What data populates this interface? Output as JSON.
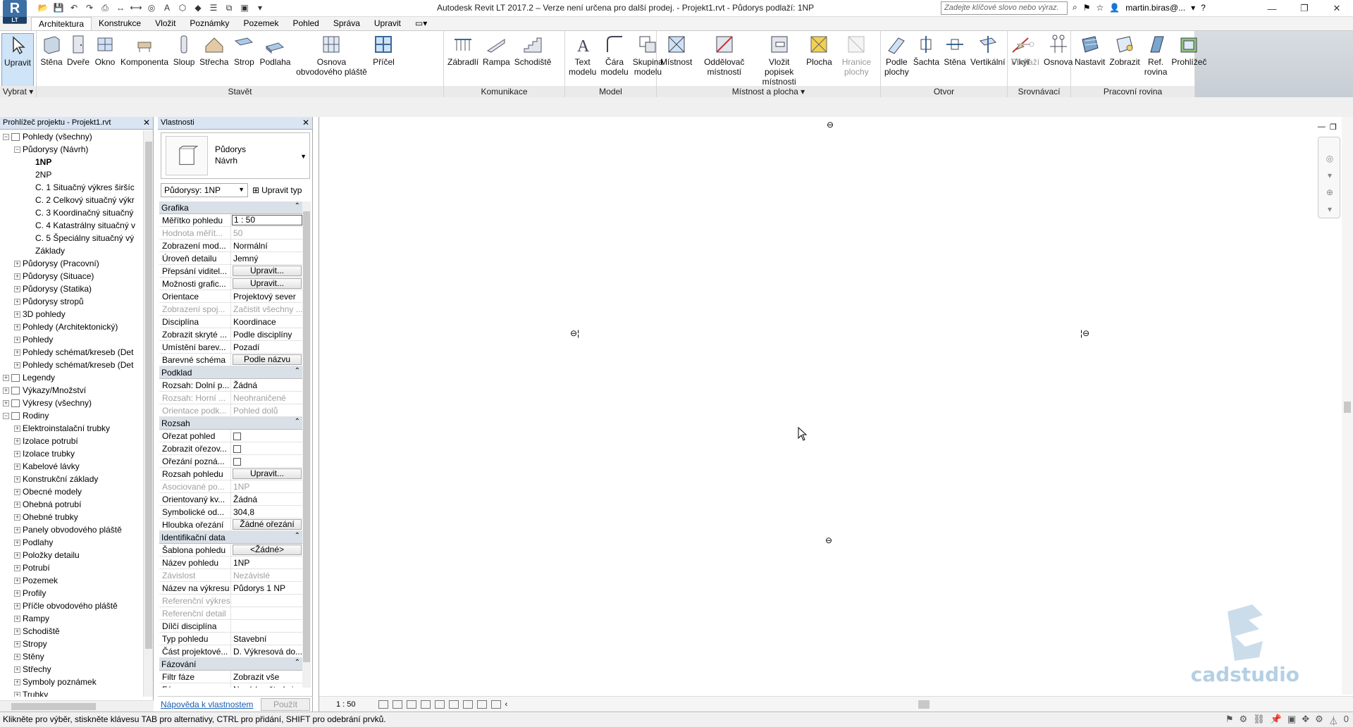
{
  "app": {
    "logo": "R",
    "logo_sub": "LT",
    "title": "Autodesk Revit LT 2017.2 – Verze není určena pro další prodej. -    Projekt1.rvt - Půdorys podlaží: 1NP",
    "search_placeholder": "Zadejte klíčové slovo nebo výraz.",
    "user": "martin.biras@...",
    "help": "?"
  },
  "tabs": [
    "Architektura",
    "Konstrukce",
    "Vložit",
    "Poznámky",
    "Pozemek",
    "Pohled",
    "Správa",
    "Upravit"
  ],
  "ribbon": {
    "panels": [
      {
        "title": "Vybrat ▾",
        "buttons": [
          "Upravit"
        ]
      },
      {
        "title": "Stavět",
        "buttons": [
          "Stěna",
          "Dveře",
          "Okno",
          "Komponenta",
          "Sloup",
          "Střecha",
          "Strop",
          "Podlaha",
          "Osnova obvodového pláště",
          "Příčel"
        ]
      },
      {
        "title": "Komunikace",
        "buttons": [
          "Zábradlí",
          "Rampa",
          "Schodiště"
        ]
      },
      {
        "title": "Model",
        "buttons": [
          "Text modelu",
          "Čára modelu",
          "Skupina modelu"
        ]
      },
      {
        "title": "Místnost a plocha ▾",
        "buttons": [
          "Místnost",
          "Oddělovač místností",
          "Vložit popisek místnosti",
          "Plocha",
          "Hranice plochy"
        ]
      },
      {
        "title": "Otvor",
        "buttons": [
          "Podle plochy",
          "Šachta",
          "Stěna",
          "Vertikální",
          "Vikýř"
        ]
      },
      {
        "title": "Srovnávací rovina",
        "buttons": [
          "Podlaží",
          "Osnova"
        ]
      },
      {
        "title": "Pracovní rovina",
        "buttons": [
          "Nastavit",
          "Zobrazit",
          "Ref. rovina",
          "Prohlížeč"
        ]
      }
    ]
  },
  "browser": {
    "title": "Prohlížeč projektu - Projekt1.rvt",
    "items": [
      {
        "label": "Pohledy (všechny)",
        "level": 0,
        "tog": "−",
        "icon": true
      },
      {
        "label": "Půdorysy (Návrh)",
        "level": 1,
        "tog": "−"
      },
      {
        "label": "1NP",
        "level": 2,
        "bold": true
      },
      {
        "label": "2NP",
        "level": 2
      },
      {
        "label": "C. 1 Situačný výkres širšíc",
        "level": 2
      },
      {
        "label": "C. 2 Celkový situačný výkr",
        "level": 2
      },
      {
        "label": "C. 3 Koordinačný situačný",
        "level": 2
      },
      {
        "label": "C. 4 Katastrálny situačný v",
        "level": 2
      },
      {
        "label": "C. 5 Špeciálny situačný vý",
        "level": 2
      },
      {
        "label": "Základy",
        "level": 2
      },
      {
        "label": "Půdorysy (Pracovní)",
        "level": 1,
        "tog": "+"
      },
      {
        "label": "Půdorysy (Situace)",
        "level": 1,
        "tog": "+"
      },
      {
        "label": "Půdorysy (Statika)",
        "level": 1,
        "tog": "+"
      },
      {
        "label": "Půdorysy stropů",
        "level": 1,
        "tog": "+"
      },
      {
        "label": "3D pohledy",
        "level": 1,
        "tog": "+"
      },
      {
        "label": "Pohledy (Architektonický)",
        "level": 1,
        "tog": "+"
      },
      {
        "label": "Pohledy",
        "level": 1,
        "tog": "+"
      },
      {
        "label": "Pohledy schémat/kreseb (Det",
        "level": 1,
        "tog": "+"
      },
      {
        "label": "Pohledy schémat/kreseb (Det",
        "level": 1,
        "tog": "+"
      },
      {
        "label": "Legendy",
        "level": 0,
        "tog": "+",
        "icon": true
      },
      {
        "label": "Výkazy/Množství",
        "level": 0,
        "tog": "+",
        "icon": true
      },
      {
        "label": "Výkresy (všechny)",
        "level": 0,
        "tog": "+",
        "icon": true
      },
      {
        "label": "Rodiny",
        "level": 0,
        "tog": "−",
        "icon": true
      },
      {
        "label": "Elektroinstalační trubky",
        "level": 1,
        "tog": "+"
      },
      {
        "label": "Izolace potrubí",
        "level": 1,
        "tog": "+"
      },
      {
        "label": "Izolace trubky",
        "level": 1,
        "tog": "+"
      },
      {
        "label": "Kabelové lávky",
        "level": 1,
        "tog": "+"
      },
      {
        "label": "Konstrukční základy",
        "level": 1,
        "tog": "+"
      },
      {
        "label": "Obecné modely",
        "level": 1,
        "tog": "+"
      },
      {
        "label": "Ohebná potrubí",
        "level": 1,
        "tog": "+"
      },
      {
        "label": "Ohebné trubky",
        "level": 1,
        "tog": "+"
      },
      {
        "label": "Panely obvodového pláště",
        "level": 1,
        "tog": "+"
      },
      {
        "label": "Podlahy",
        "level": 1,
        "tog": "+"
      },
      {
        "label": "Položky detailu",
        "level": 1,
        "tog": "+"
      },
      {
        "label": "Potrubí",
        "level": 1,
        "tog": "+"
      },
      {
        "label": "Pozemek",
        "level": 1,
        "tog": "+"
      },
      {
        "label": "Profily",
        "level": 1,
        "tog": "+"
      },
      {
        "label": "Příčle obvodového pláště",
        "level": 1,
        "tog": "+"
      },
      {
        "label": "Rampy",
        "level": 1,
        "tog": "+"
      },
      {
        "label": "Schodiště",
        "level": 1,
        "tog": "+"
      },
      {
        "label": "Stropy",
        "level": 1,
        "tog": "+"
      },
      {
        "label": "Stěny",
        "level": 1,
        "tog": "+"
      },
      {
        "label": "Střechy",
        "level": 1,
        "tog": "+"
      },
      {
        "label": "Symboly poznámek",
        "level": 1,
        "tog": "+"
      },
      {
        "label": "Trubky",
        "level": 1,
        "tog": "+"
      }
    ]
  },
  "properties": {
    "title": "Vlastnosti",
    "type_line1": "Půdorys",
    "type_line2": "Návrh",
    "instance": "Půdorysy: 1NP",
    "edit_type": "Upravit typ",
    "help": "Nápověda k vlastnostem",
    "apply": "Použít",
    "groups": [
      {
        "name": "Grafika",
        "rows": [
          {
            "k": "Měřítko pohledu",
            "v": "1 : 50",
            "kind": "input"
          },
          {
            "k": "Hodnota měřít...",
            "v": "50",
            "dis": true
          },
          {
            "k": "Zobrazení mod...",
            "v": "Normální"
          },
          {
            "k": "Úroveň detailu",
            "v": "Jemný"
          },
          {
            "k": "Přepsání viditel...",
            "v": "Upravit...",
            "kind": "btn"
          },
          {
            "k": "Možnosti grafic...",
            "v": "Upravit...",
            "kind": "btn"
          },
          {
            "k": "Orientace",
            "v": "Projektový sever"
          },
          {
            "k": "Zobrazení spoj...",
            "v": "Začistit všechny ...",
            "dis": true
          },
          {
            "k": "Disciplína",
            "v": "Koordinace"
          },
          {
            "k": "Zobrazit skryté ...",
            "v": "Podle disciplíny"
          },
          {
            "k": "Umístění barev...",
            "v": "Pozadí"
          },
          {
            "k": "Barevné schéma",
            "v": "Podle názvu",
            "kind": "btn"
          }
        ]
      },
      {
        "name": "Podklad",
        "rows": [
          {
            "k": "Rozsah: Dolní p...",
            "v": "Žádná"
          },
          {
            "k": "Rozsah: Horní ...",
            "v": "Neohraničené",
            "dis": true
          },
          {
            "k": "Orientace podk...",
            "v": "Pohled dolů",
            "dis": true
          }
        ]
      },
      {
        "name": "Rozsah",
        "rows": [
          {
            "k": "Ořezat pohled",
            "v": "",
            "kind": "cb"
          },
          {
            "k": "Zobrazit ořezov...",
            "v": "",
            "kind": "cb"
          },
          {
            "k": "Ořezání pozná...",
            "v": "",
            "kind": "cb"
          },
          {
            "k": "Rozsah pohledu",
            "v": "Upravit...",
            "kind": "btn"
          },
          {
            "k": "Asociované po...",
            "v": "1NP",
            "dis": true
          },
          {
            "k": "Orientovaný kv...",
            "v": "Žádná"
          },
          {
            "k": "Symbolické od...",
            "v": "304,8"
          },
          {
            "k": "Hloubka ořezání",
            "v": "Žádné ořezání",
            "kind": "btn"
          }
        ]
      },
      {
        "name": "Identifikační data",
        "rows": [
          {
            "k": "Šablona pohledu",
            "v": "<Žádné>",
            "kind": "btn"
          },
          {
            "k": "Název pohledu",
            "v": "1NP"
          },
          {
            "k": "Závislost",
            "v": "Nezávislé",
            "dis": true
          },
          {
            "k": "Název na výkresu",
            "v": "Půdorys 1 NP"
          },
          {
            "k": "Referenční výkres",
            "v": "",
            "dis": true
          },
          {
            "k": "Referenční detail",
            "v": "",
            "dis": true
          },
          {
            "k": "Dílčí disciplína",
            "v": ""
          },
          {
            "k": "Typ pohledu",
            "v": "Stavební"
          },
          {
            "k": "Část projektové...",
            "v": "D. Výkresová do..."
          }
        ]
      },
      {
        "name": "Fázování",
        "rows": [
          {
            "k": "Filtr fáze",
            "v": "Zobrazit vše"
          },
          {
            "k": "Fáze",
            "v": "Nová konštrukcia"
          }
        ]
      }
    ]
  },
  "view": {
    "scale": "1 : 50",
    "watermark": "cadstudio"
  },
  "status": {
    "text": "Klikněte pro výběr, stiskněte klávesu TAB pro alternativy, CTRL pro přidání, SHIFT pro odebrání prvků.",
    "filter": "0"
  },
  "colors": {
    "accent": "#3d6fa5",
    "panel_header": "#d9e5f2",
    "watermark": "#b5cfe3"
  }
}
